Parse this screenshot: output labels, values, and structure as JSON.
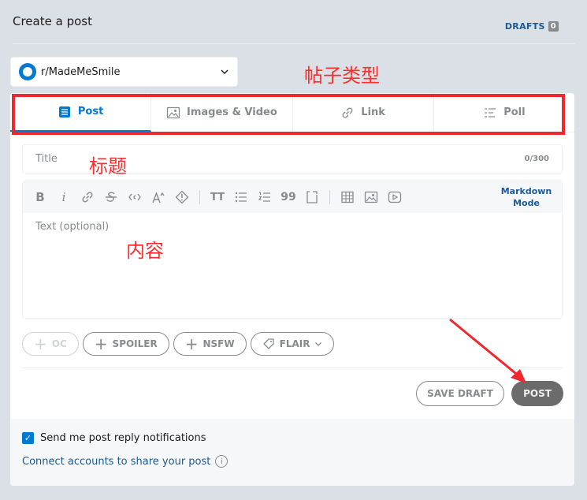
{
  "header": {
    "title": "Create a post",
    "drafts_label": "DRAFTS",
    "drafts_count": "0"
  },
  "community": {
    "name": "r/MadeMeSmile"
  },
  "annotations": {
    "post_type": "帖子类型",
    "title": "标题",
    "content": "内容"
  },
  "tabs": [
    {
      "label": "Post",
      "icon": "post-icon",
      "active": true
    },
    {
      "label": "Images & Video",
      "icon": "image-icon",
      "active": false
    },
    {
      "label": "Link",
      "icon": "link-icon",
      "active": false
    },
    {
      "label": "Poll",
      "icon": "poll-icon",
      "active": false
    }
  ],
  "title_field": {
    "placeholder": "Title",
    "counter": "0/300"
  },
  "editor": {
    "toolbar": {
      "bold": "B",
      "italic": "i",
      "text_size": "TT",
      "quote": "99",
      "markdown_mode": "Markdown Mode"
    },
    "placeholder": "Text (optional)"
  },
  "flairs": {
    "oc": "OC",
    "spoiler": "SPOILER",
    "nsfw": "NSFW",
    "flair": "FLAIR"
  },
  "actions": {
    "save_draft": "SAVE DRAFT",
    "post": "POST"
  },
  "footer": {
    "notify_label": "Send me post reply notifications",
    "connect_label": "Connect accounts to share your post"
  },
  "colors": {
    "accent": "#0079d3",
    "annotation": "#f0282d",
    "background": "#dae0e6"
  }
}
